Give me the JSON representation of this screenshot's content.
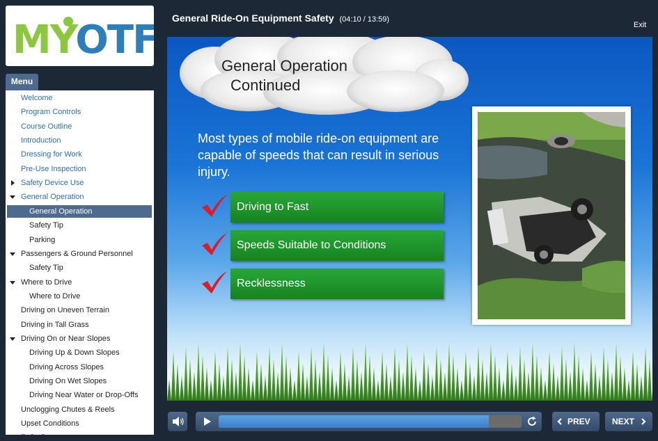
{
  "logo": {
    "text": "MYOTF"
  },
  "menu": {
    "tab_label": "Menu",
    "items": [
      {
        "label": "Welcome",
        "level": 0,
        "arrow": "none",
        "state": "link"
      },
      {
        "label": "Program Controls",
        "level": 0,
        "arrow": "none",
        "state": "link"
      },
      {
        "label": "Course Outline",
        "level": 0,
        "arrow": "none",
        "state": "link"
      },
      {
        "label": "Introduction",
        "level": 0,
        "arrow": "none",
        "state": "link"
      },
      {
        "label": "Dressing for Work",
        "level": 0,
        "arrow": "none",
        "state": "link"
      },
      {
        "label": "Pre-Use Inspection",
        "level": 0,
        "arrow": "none",
        "state": "link"
      },
      {
        "label": "Safety Device Use",
        "level": 0,
        "arrow": "right",
        "state": "link"
      },
      {
        "label": "General Operation",
        "level": 0,
        "arrow": "down",
        "state": "link"
      },
      {
        "label": "General Operation",
        "level": 1,
        "arrow": "none",
        "state": "active"
      },
      {
        "label": "Safety Tip",
        "level": 1,
        "arrow": "none",
        "state": "plain"
      },
      {
        "label": "Parking",
        "level": 1,
        "arrow": "none",
        "state": "plain"
      },
      {
        "label": "Passengers & Ground Personnel",
        "level": 0,
        "arrow": "down",
        "state": "plain"
      },
      {
        "label": "Safety Tip",
        "level": 1,
        "arrow": "none",
        "state": "plain"
      },
      {
        "label": "Where to Drive",
        "level": 0,
        "arrow": "down",
        "state": "plain"
      },
      {
        "label": "Where to Drive",
        "level": 1,
        "arrow": "none",
        "state": "plain"
      },
      {
        "label": "Driving on Uneven Terrain",
        "level": 0,
        "arrow": "none",
        "state": "plain"
      },
      {
        "label": "Driving in Tall Grass",
        "level": 0,
        "arrow": "none",
        "state": "plain"
      },
      {
        "label": "Driving On or Near Slopes",
        "level": 0,
        "arrow": "down",
        "state": "plain"
      },
      {
        "label": "Driving Up & Down Slopes",
        "level": 1,
        "arrow": "none",
        "state": "plain"
      },
      {
        "label": "Driving Across Slopes",
        "level": 1,
        "arrow": "none",
        "state": "plain"
      },
      {
        "label": "Driving On Wet Slopes",
        "level": 1,
        "arrow": "none",
        "state": "plain"
      },
      {
        "label": "Driving Near Water or Drop-Offs",
        "level": 1,
        "arrow": "none",
        "state": "plain"
      },
      {
        "label": "Unclogging Chutes & Reels",
        "level": 0,
        "arrow": "none",
        "state": "plain"
      },
      {
        "label": "Upset Conditions",
        "level": 0,
        "arrow": "none",
        "state": "plain"
      },
      {
        "label": "Refuelin",
        "level": 0,
        "arrow": "none",
        "state": "plain"
      }
    ]
  },
  "header": {
    "title": "General Ride-On Equipment Safety",
    "time": "(04:10 / 13:59)",
    "exit_label": "Exit"
  },
  "slide": {
    "heading_line1": "General Operation",
    "heading_line2": "Continued",
    "intro_text": "Most types of mobile ride-on equipment are capable of speeds that can result in serious injury.",
    "bullets": [
      "Driving to Fast",
      "Speeds Suitable to Conditions",
      "Recklessness"
    ]
  },
  "controls": {
    "progress": 0.893,
    "prev_label": "PREV",
    "next_label": "NEXT",
    "icons": {
      "mute": "speaker-icon",
      "play": "play-icon",
      "replay": "replay-icon",
      "prev": "chevron-left-icon",
      "next": "chevron-right-icon"
    }
  },
  "colors": {
    "background": "#1c2836",
    "menu_active": "#4e6a8e",
    "menu_link": "#2e6fb0",
    "bullet_green": "#1e9229",
    "check_red": "#d81e2c",
    "progress_fill": "#3a7fc8"
  }
}
